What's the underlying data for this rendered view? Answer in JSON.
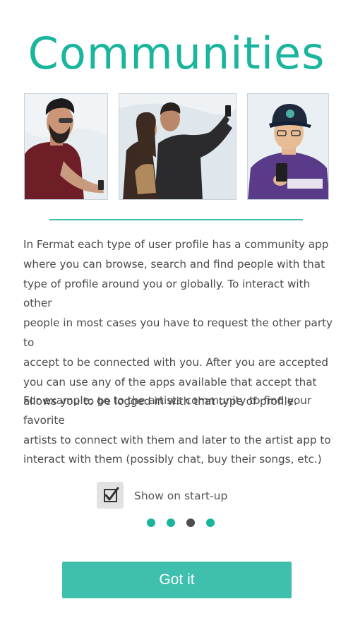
{
  "header": {
    "title": "Communities"
  },
  "photos": [
    {
      "subject": "man-with-phone"
    },
    {
      "subject": "couple-taking-selfie"
    },
    {
      "subject": "man-in-cap-with-phone"
    }
  ],
  "content": {
    "paragraph_1": "In Fermat each type of user profile has a community app\nwhere you can browse, search and find people with that\ntype of profile around you or globally. To interact with other\npeople in most cases you have to request the other party to\naccept to be connected with you. After you are accepted\nyou can use any of the apps available that accept that\nallows you to be logged in with that type of profile.",
    "paragraph_2": "For example: go to the artists community to find your favorite\nartists to connect with them and later to the artist app to\ninteract with them (possibly chat, buy their songs, etc.)"
  },
  "startup": {
    "label": "Show on start-up",
    "checked": true
  },
  "pager": {
    "count": 4,
    "active_index": 2
  },
  "actions": {
    "got_it_label": "Got it"
  },
  "colors": {
    "accent": "#1ab59d",
    "button": "#3fbfad",
    "active_dot": "#4d4d4d",
    "body_text": "#4a4a4a"
  }
}
